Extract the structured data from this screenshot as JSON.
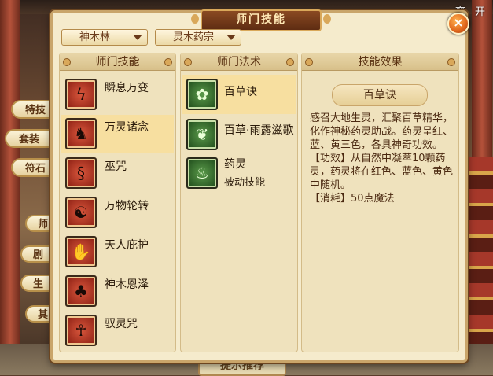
{
  "top_right": {
    "leave_text": "离 开"
  },
  "side_tabs": [
    "特技",
    "套装",
    "符石"
  ],
  "side_tabs2": [
    "师",
    "剧",
    "生",
    "其"
  ],
  "bottom_peek": "提示推荐",
  "window": {
    "title": "师门技能",
    "close": "×"
  },
  "selects": [
    {
      "value": "神木林"
    },
    {
      "value": "灵木药宗"
    }
  ],
  "columns": {
    "skills_header": "师门技能",
    "spells_header": "师门法术",
    "effect_header": "技能效果"
  },
  "skills": [
    {
      "name": "瞬息万变",
      "icon": "lightning-icon",
      "glyph": "ϟ"
    },
    {
      "name": "万灵诸念",
      "icon": "spirit-beast-icon",
      "glyph": "♞",
      "selected": true
    },
    {
      "name": "巫咒",
      "icon": "curse-swirl-icon",
      "glyph": "§"
    },
    {
      "name": "万物轮转",
      "icon": "yin-yang-icon",
      "glyph": "☯"
    },
    {
      "name": "天人庇护",
      "icon": "praying-hands-icon",
      "glyph": "✋"
    },
    {
      "name": "神木恩泽",
      "icon": "sacred-tree-icon",
      "glyph": "♣"
    },
    {
      "name": "驭灵咒",
      "icon": "figure-icon",
      "glyph": "☥"
    }
  ],
  "spells": [
    {
      "name": "百草诀",
      "sub": "",
      "icon": "herb-swirl-icon",
      "glyph": "✿",
      "selected": true
    },
    {
      "name": "百草·雨露滋歌",
      "sub": "",
      "icon": "leaf-drops-icon",
      "glyph": "❦"
    },
    {
      "name": "药灵",
      "sub": "被动技能",
      "icon": "flame-leaf-icon",
      "glyph": "♨"
    }
  ],
  "effect": {
    "title": "百草诀",
    "description": "感召大地生灵，汇聚百草精华，化作神秘药灵助战。药灵呈红、蓝、黄三色，各具神奇功效。\n【功效】从自然中凝萃10颗药灵，药灵将在红色、蓝色、黄色中随机。\n【消耗】50点魔法"
  }
}
